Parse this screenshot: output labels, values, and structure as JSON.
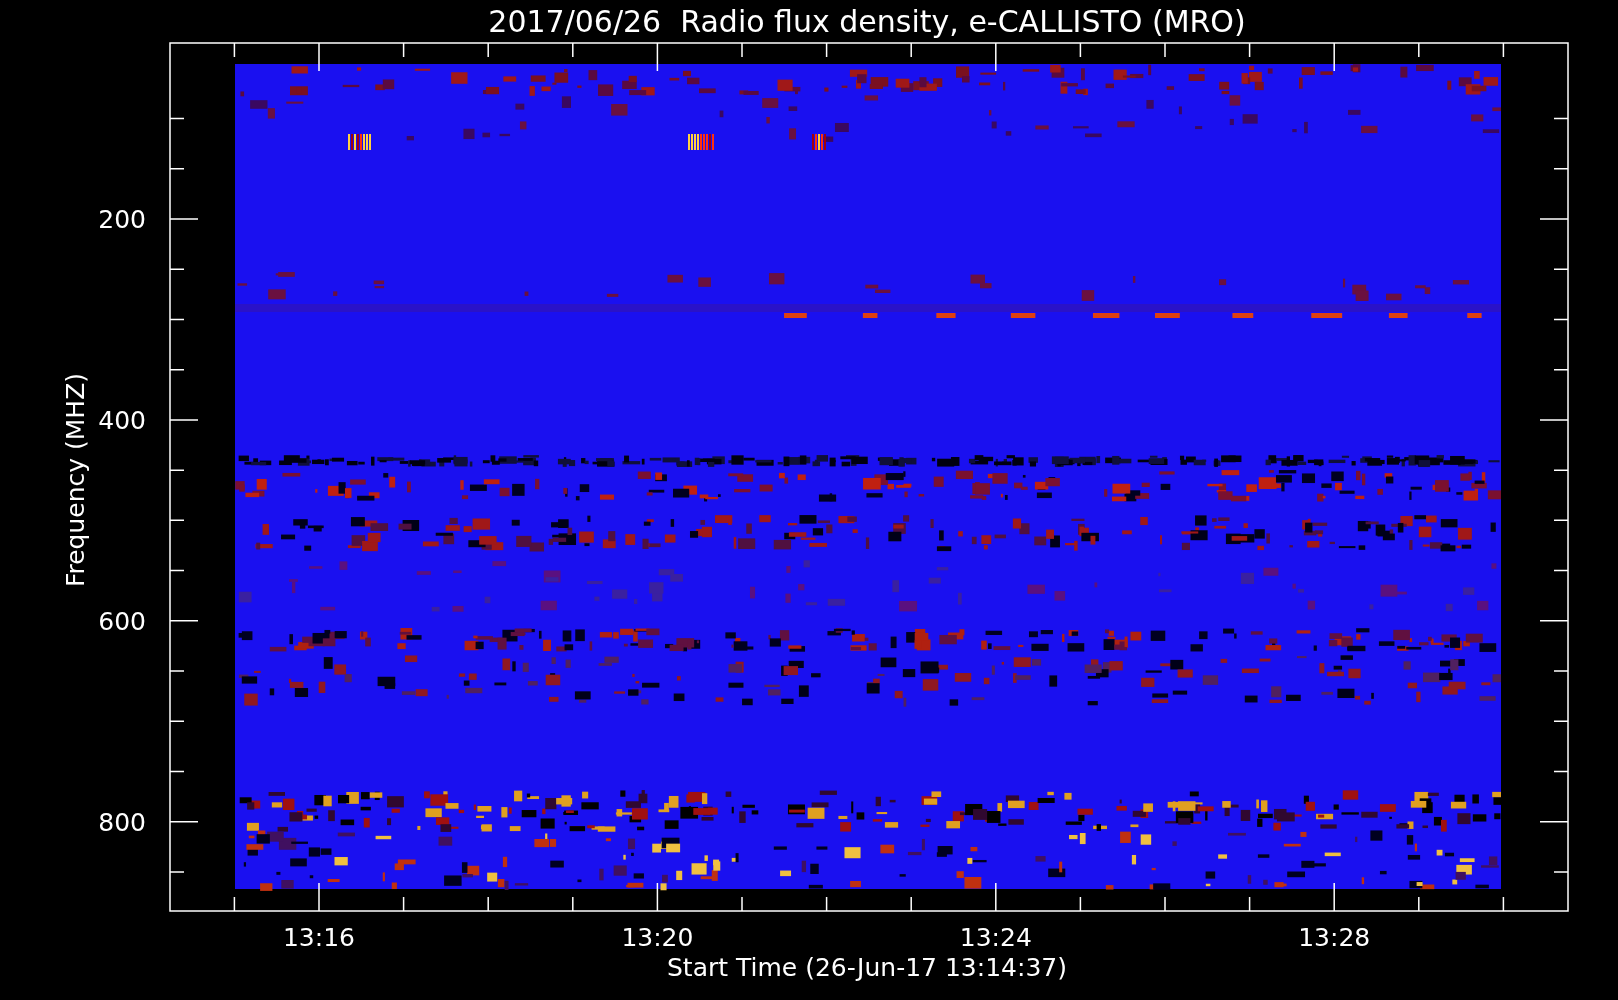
{
  "plot": {
    "title": "2017/06/26  Radio flux density, e-CALLISTO (MRO)",
    "ylabel": "Frequency (MHZ)",
    "xlabel": "Start Time (26-Jun-17 13:14:37)",
    "yticks": [
      "200",
      "400",
      "600",
      "800"
    ],
    "xticks": [
      "13:16",
      "13:20",
      "13:24",
      "13:28"
    ]
  }
}
